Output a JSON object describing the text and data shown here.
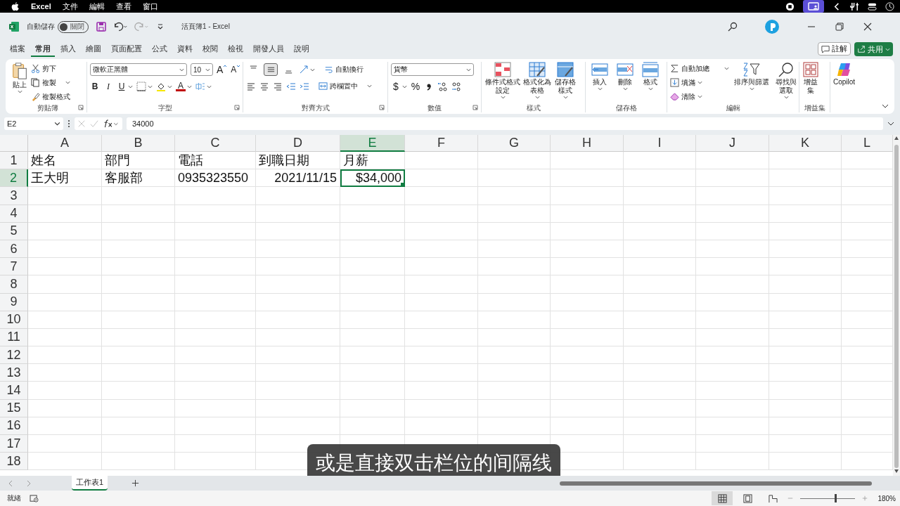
{
  "menubar": {
    "app": "Excel",
    "items": [
      "文件",
      "編輯",
      "查看",
      "窗口"
    ]
  },
  "titlebar": {
    "autosave": {
      "label": "自動儲存",
      "on": false,
      "state_text": "關閉"
    },
    "title": "活頁簿1  -  Excel"
  },
  "tabs": [
    {
      "label": "檔案",
      "selected": false
    },
    {
      "label": "常用",
      "selected": true
    },
    {
      "label": "插入",
      "selected": false
    },
    {
      "label": "繪圖",
      "selected": false
    },
    {
      "label": "頁面配置",
      "selected": false
    },
    {
      "label": "公式",
      "selected": false
    },
    {
      "label": "資料",
      "selected": false
    },
    {
      "label": "校閱",
      "selected": false
    },
    {
      "label": "檢視",
      "selected": false
    },
    {
      "label": "開發人員",
      "selected": false
    },
    {
      "label": "說明",
      "selected": false
    }
  ],
  "actions": {
    "comment": "註解",
    "share": "共用"
  },
  "ribbon": {
    "clipboard": {
      "label": "剪貼簿",
      "paste": "貼上",
      "cut": "剪下",
      "copy": "複製",
      "format_painter": "複製格式"
    },
    "font": {
      "label": "字型",
      "font_name": "微軟正黑體",
      "font_size": "10",
      "grow": "A",
      "shrink": "A",
      "bold": "B",
      "italic": "I",
      "underline": "U",
      "font_color": "A"
    },
    "alignment": {
      "label": "對齊方式",
      "vertical": [
        {
          "selected": false
        },
        {
          "selected": true
        },
        {
          "selected": false
        }
      ],
      "wrap_text": "自動換行",
      "merge_center": "跨欄置中"
    },
    "number": {
      "label": "數值",
      "format": "貨幣",
      "currency": "$",
      "percent": "%"
    },
    "styles": {
      "label": "樣式",
      "conditional": "條件式格式設定",
      "format_table": "格式化為表格",
      "cell_styles": "儲存格樣式"
    },
    "cells": {
      "label": "儲存格",
      "insert": "插入",
      "delete": "刪除",
      "format": "格式"
    },
    "editing": {
      "label": "編輯",
      "autosum": "自動加總",
      "fill": "填滿",
      "clear": "清除",
      "sort_filter": "排序與篩選",
      "find_select": "尋找與選取"
    },
    "addins": {
      "label": "增益集",
      "button": "增益集"
    },
    "copilot": "Copilot"
  },
  "formula_bar": {
    "name_box": "E2",
    "formula": "34000"
  },
  "sheet": {
    "columns": [
      {
        "label": "A",
        "selected": false
      },
      {
        "label": "B",
        "selected": false
      },
      {
        "label": "C",
        "selected": false
      },
      {
        "label": "D",
        "selected": false
      },
      {
        "label": "E",
        "selected": true
      },
      {
        "label": "F",
        "selected": false
      },
      {
        "label": "G",
        "selected": false
      },
      {
        "label": "H",
        "selected": false
      },
      {
        "label": "I",
        "selected": false
      },
      {
        "label": "J",
        "selected": false
      },
      {
        "label": "K",
        "selected": false
      },
      {
        "label": "L",
        "selected": false
      }
    ],
    "row_headers": [
      {
        "label": "1",
        "selected": false
      },
      {
        "label": "2",
        "selected": true
      },
      {
        "label": "3",
        "selected": false
      },
      {
        "label": "4",
        "selected": false
      },
      {
        "label": "5",
        "selected": false
      },
      {
        "label": "6",
        "selected": false
      },
      {
        "label": "7",
        "selected": false
      },
      {
        "label": "8",
        "selected": false
      },
      {
        "label": "9",
        "selected": false
      },
      {
        "label": "10",
        "selected": false
      },
      {
        "label": "11",
        "selected": false
      },
      {
        "label": "12",
        "selected": false
      },
      {
        "label": "13",
        "selected": false
      },
      {
        "label": "14",
        "selected": false
      },
      {
        "label": "15",
        "selected": false
      },
      {
        "label": "16",
        "selected": false
      },
      {
        "label": "17",
        "selected": false
      },
      {
        "label": "18",
        "selected": false
      }
    ],
    "rows": [
      [
        {
          "text": "姓名",
          "kind": "text",
          "selected": false
        },
        {
          "text": "部門",
          "kind": "text",
          "selected": false
        },
        {
          "text": "電話",
          "kind": "text",
          "selected": false
        },
        {
          "text": "到職日期",
          "kind": "text",
          "selected": false
        },
        {
          "text": "月薪",
          "kind": "text",
          "selected": false
        }
      ],
      [
        {
          "text": "王大明",
          "kind": "text",
          "selected": false
        },
        {
          "text": "客服部",
          "kind": "text",
          "selected": false
        },
        {
          "text": "0935323550",
          "kind": "text",
          "selected": false
        },
        {
          "text": "2021/11/15",
          "kind": "number",
          "selected": false
        },
        {
          "text": "$34,000",
          "kind": "number",
          "selected": true
        }
      ]
    ]
  },
  "sheet_tabs": [
    {
      "label": "工作表1",
      "selected": true
    }
  ],
  "status_bar": {
    "status": "就緒",
    "views": [
      {
        "selected": true
      },
      {
        "selected": false
      },
      {
        "selected": false
      }
    ],
    "zoom_slider": {
      "level": 0.63
    },
    "zoom": "180%"
  },
  "caption": "或是直接双击栏位的间隔线"
}
